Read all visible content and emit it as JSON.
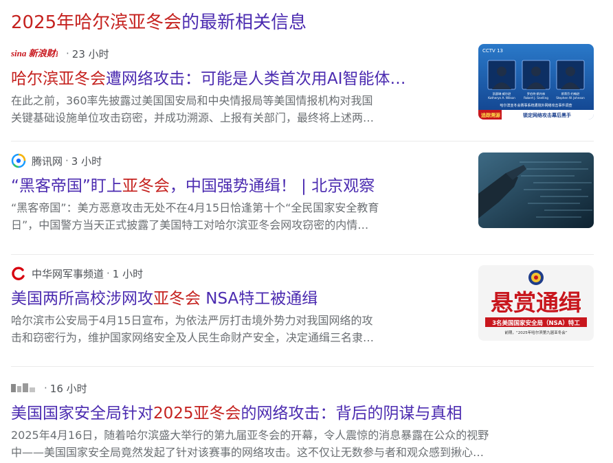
{
  "heading": {
    "highlight": "2025年哈尔滨亚冬会",
    "rest": "的最新相关信息"
  },
  "items": [
    {
      "source": "",
      "logo_text": "sina 新浪财经",
      "time": "23 小时",
      "title_hl": "哈尔滨亚冬会",
      "title_rest": "遭网络攻击：可能是人类首次用AI智能体…",
      "snippet_line1": "在此之前，360率先披露过美国国安局和中央情报局等美国情报机构对我国",
      "snippet_line2": "关键基础设施单位攻击窃密，并成功溯源、上报有关部门，最终将上述两…",
      "thumb": {
        "badge": "CCTV 13",
        "names": [
          "凯瑟琳·威尔逊",
          "罗伯特·斯内林",
          "斯蒂芬·约翰逊"
        ],
        "subnames": [
          "Katheryn A. Wilson",
          "Robert J. Snelling",
          "Stephen W. Johnson"
        ],
        "caption": "哈尔滨亚冬会赛事系统遭境外网络攻击事件调查",
        "ticker_left": "追踪溯源",
        "ticker_right": "锁定网络攻击幕后黑手"
      }
    },
    {
      "source": "腾讯网",
      "time": "3 小时",
      "title_pre": "“黑客帝国”盯上",
      "title_hl": "亚冬会",
      "title_rest": "，中国强势通缉！ | 北京观察",
      "snippet_line1": "“黑客帝国”：美方恶意攻击无处不在4月15日恰逢第十个“全民国家安全教育",
      "snippet_line2": "日”，中国警方当天正式披露了美国特工对哈尔滨亚冬会网攻窃密的内情…"
    },
    {
      "source": "中华网军事频道",
      "time": "1 小时",
      "title_pre": "美国两所高校涉网攻",
      "title_hl": "亚冬会",
      "title_rest": " NSA特工被通缉",
      "snippet_line1": "哈尔滨市公安局于4月15日宣布，为依法严厉打击境外势力对我国网络的攻",
      "snippet_line2": "击和窃密行为，维护国家网络安全及人民生命财产安全，决定通缉三名隶…",
      "thumb": {
        "headline": "悬赏通缉",
        "subline": "3名美国国家安全局（NSA）特工",
        "footnote": "前期，“2025年哈尔滨第九届亚冬会”"
      }
    },
    {
      "source": "",
      "time": "16 小时",
      "title_pre": "美国国家安全局针对",
      "title_hl": "2025亚冬会",
      "title_rest": "的网络攻击：背后的阴谋与真相",
      "snippet_line1": "2025年4月16日，随着哈尔滨盛大举行的第九届亚冬会的开幕，令人震惊的消息暴露在公众的视野",
      "snippet_line2": "中——美国国家安全局竟然发起了针对该赛事的网络攻击。这不仅让无数参与者和观众感到揪心…"
    }
  ],
  "colors": {
    "title": "#4b2bb0",
    "highlight": "#c5221f",
    "snippet": "#6b6f73"
  }
}
